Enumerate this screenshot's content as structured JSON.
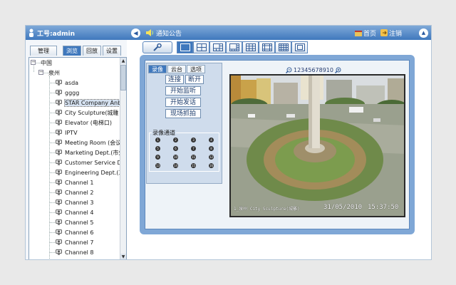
{
  "header": {
    "user_label": "工号:admin",
    "notice_label": "通知公告",
    "home_label": "首页",
    "logout_label": "注销"
  },
  "left": {
    "tabs": [
      {
        "label": "管理",
        "active": false
      },
      {
        "label": "浏览",
        "active": true
      },
      {
        "label": "回放",
        "active": false
      },
      {
        "label": "设置",
        "active": false
      }
    ],
    "tree": {
      "root": "中国",
      "city": "泉州",
      "items": [
        {
          "label": "asda"
        },
        {
          "label": "gggg"
        },
        {
          "label": "STAR Company Anb"
        },
        {
          "label": "City Sculpture(城雕"
        },
        {
          "label": "Elevator (电梯口)"
        },
        {
          "label": "IPTV"
        },
        {
          "label": "Meeting Room (会议"
        },
        {
          "label": "Marketing Dept.(市外"
        },
        {
          "label": "Customer Service De"
        },
        {
          "label": "Engineering Dept.(工"
        },
        {
          "label": "Channel 1"
        },
        {
          "label": "Channel 2"
        },
        {
          "label": "Channel 3"
        },
        {
          "label": "Channel 4"
        },
        {
          "label": "Channel 5"
        },
        {
          "label": "Channel 6"
        },
        {
          "label": "Channel 7"
        },
        {
          "label": "Channel 8"
        }
      ],
      "selected_index": 2
    }
  },
  "control": {
    "tabs": [
      {
        "label": "录像",
        "active": true
      },
      {
        "label": "云台",
        "active": false
      },
      {
        "label": "选项",
        "active": false
      }
    ],
    "connect_label": "连接",
    "disconnect_label": "断开",
    "start_monitor_label": "开始监听",
    "start_talk_label": "开始发话",
    "capture_label": "现场抓拍",
    "record_channels_label": "录像通道",
    "channels": [
      "1",
      "2",
      "3",
      "4",
      "5",
      "6",
      "7",
      "8",
      "9",
      "10",
      "11",
      "12",
      "13",
      "14",
      "15",
      "16"
    ]
  },
  "zoom": {
    "levels": "12345678910"
  },
  "video": {
    "camera_name": "1_泉州 City Sculpture(城雕)",
    "date": "31/05/2010",
    "time": "15:37:50"
  },
  "colors": {
    "accent": "#3f78bd",
    "panel": "#7fa7d6"
  }
}
